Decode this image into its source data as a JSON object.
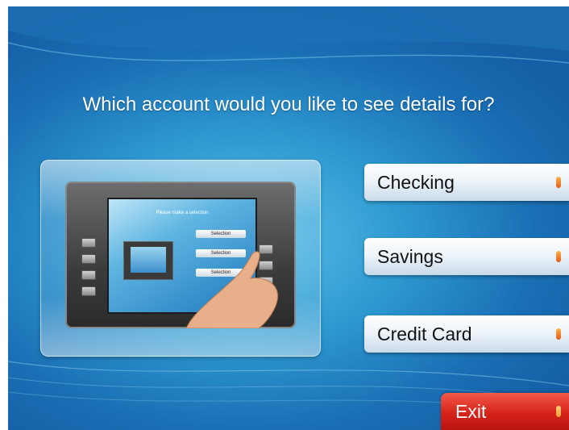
{
  "prompt": "Which account would you like to see details for?",
  "illustration": {
    "screen_title": "Please make a selection",
    "buttons": [
      "Selection",
      "Selection",
      "Selection"
    ]
  },
  "options": [
    {
      "label": "Checking"
    },
    {
      "label": "Savings"
    },
    {
      "label": "Credit Card"
    }
  ],
  "exit": {
    "label": "Exit"
  },
  "colors": {
    "background": "#2e9ad2",
    "option_button": "#eef4f9",
    "exit_button": "#d6231a",
    "arrow_accent": "#e25a1a"
  }
}
